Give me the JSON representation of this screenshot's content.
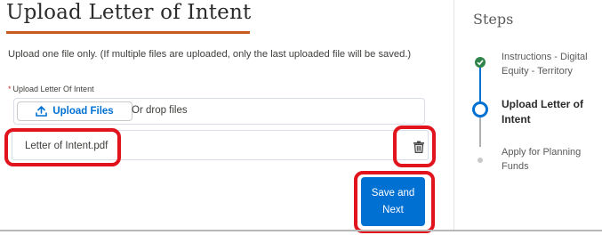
{
  "page": {
    "title": "Upload Letter of Intent",
    "instructions": "Upload one file only.  (If multiple files are uploaded, only the last uploaded file will be saved.)"
  },
  "upload": {
    "required_marker": "*",
    "field_label": "Upload Letter Of Intent",
    "button_label": "Upload Files",
    "button_icon": "upload-icon",
    "drop_text": "Or drop files"
  },
  "file": {
    "name": "Letter of Intent.pdf",
    "delete_icon": "trash-icon"
  },
  "actions": {
    "save_line1": "Save and",
    "save_line2": "Next"
  },
  "steps": {
    "title": "Steps",
    "items": [
      {
        "line1": "Instructions - Digital",
        "line2": "Equity - Territory",
        "status": "complete"
      },
      {
        "line1": "Upload Letter of",
        "line2": "Intent",
        "status": "current"
      },
      {
        "line1": "Apply for Planning",
        "line2": "Funds",
        "status": "pending"
      }
    ]
  },
  "colors": {
    "accent": "#0070d2",
    "title_underline": "#c85a1c",
    "highlight": "#e1141e",
    "complete": "#2e844a"
  }
}
